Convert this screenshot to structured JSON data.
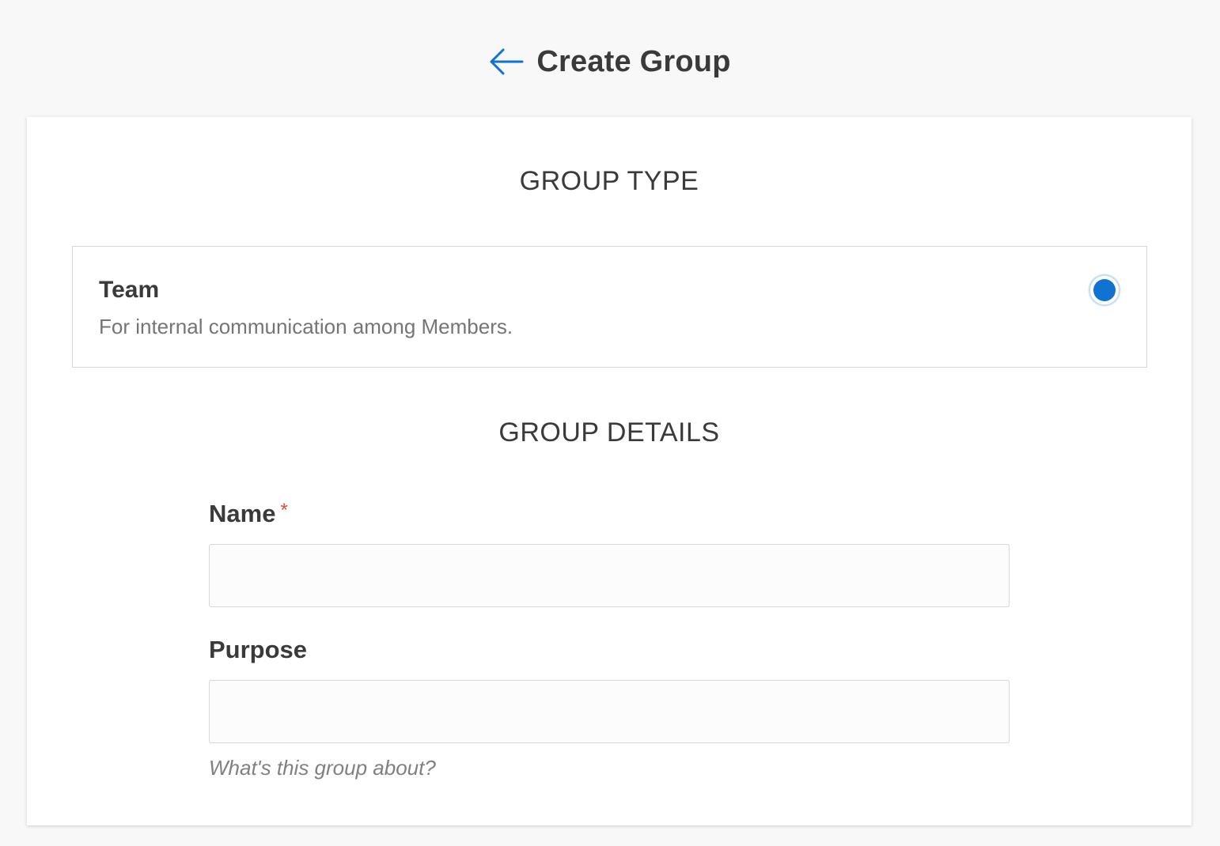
{
  "header": {
    "title": "Create Group",
    "back_icon": "arrow-left-icon",
    "accent_color": "#0f74d1"
  },
  "group_type": {
    "section_title": "GROUP TYPE",
    "options": [
      {
        "title": "Team",
        "description": "For internal communication among Members.",
        "selected": true
      }
    ]
  },
  "group_details": {
    "section_title": "GROUP DETAILS",
    "name_field": {
      "label": "Name",
      "required_mark": "*",
      "value": "",
      "placeholder": ""
    },
    "purpose_field": {
      "label": "Purpose",
      "value": "",
      "placeholder": "",
      "help_text": "What's this group about?"
    }
  }
}
